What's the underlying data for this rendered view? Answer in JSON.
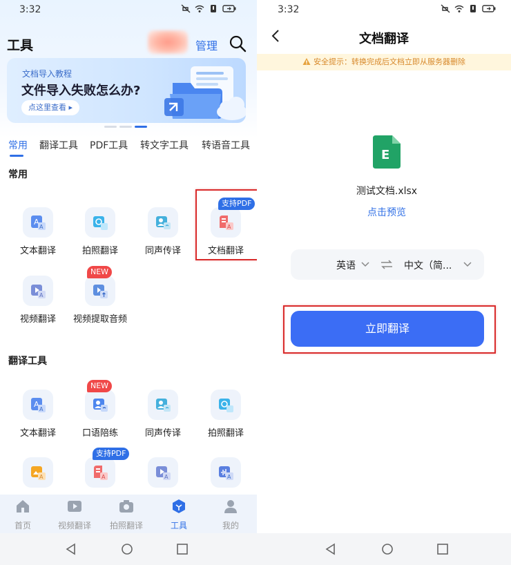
{
  "left": {
    "status": {
      "time": "3:32"
    },
    "header": {
      "title": "工具",
      "manage_label": "管理"
    },
    "banner": {
      "subtitle": "文档导入教程",
      "headline": "文件导入失败怎么办?",
      "button_label": "点这里查看 ▸"
    },
    "tabs": [
      "常用",
      "翻译工具",
      "PDF工具",
      "转文字工具",
      "转语音工具"
    ],
    "active_tab": "常用",
    "sections": {
      "common": {
        "title": "常用",
        "tools": [
          {
            "label": "文本翻译",
            "icon": "text-translate-icon"
          },
          {
            "label": "拍照翻译",
            "icon": "photo-translate-icon"
          },
          {
            "label": "同声传译",
            "icon": "simultaneous-interpret-icon"
          },
          {
            "label": "文档翻译",
            "icon": "document-translate-icon",
            "badge": "支持PDF"
          },
          {
            "label": "视频翻译",
            "icon": "video-translate-icon"
          },
          {
            "label": "视频提取音频",
            "icon": "video-extract-audio-icon",
            "badge": "NEW"
          }
        ]
      },
      "translate": {
        "title": "翻译工具",
        "tools": [
          {
            "label": "文本翻译",
            "icon": "text-translate-icon"
          },
          {
            "label": "口语陪练",
            "icon": "speaking-practice-icon",
            "badge": "NEW"
          },
          {
            "label": "同声传译",
            "icon": "simultaneous-interpret-icon"
          },
          {
            "label": "拍照翻译",
            "icon": "photo-translate-icon"
          },
          {
            "label": "",
            "icon": "image-translate-icon"
          },
          {
            "label": "",
            "icon": "document-translate-icon",
            "badge": "支持PDF"
          },
          {
            "label": "",
            "icon": "video-translate-icon"
          },
          {
            "label": "",
            "icon": "audio-translate-icon"
          }
        ]
      }
    },
    "bottom_nav": [
      {
        "label": "首页",
        "icon": "home-icon"
      },
      {
        "label": "视频翻译",
        "icon": "video-icon"
      },
      {
        "label": "拍照翻译",
        "icon": "camera-icon"
      },
      {
        "label": "工具",
        "icon": "tools-icon",
        "active": true
      },
      {
        "label": "我的",
        "icon": "profile-icon"
      }
    ]
  },
  "right": {
    "status": {
      "time": "3:32"
    },
    "header": {
      "title": "文档翻译"
    },
    "warning": "安全提示：转换完成后文档立即从服务器删除",
    "file": {
      "name": "测试文档.xlsx",
      "icon_letter": "E",
      "preview_label": "点击预览"
    },
    "languages": {
      "source": "英语",
      "target": "中文（简..."
    },
    "translate_button": "立即翻译"
  },
  "colors": {
    "accent": "#2f6fe6",
    "button": "#3b6df5",
    "highlight": "#d92b2b",
    "warning_bg": "#fff6dd",
    "warning_text": "#d7882a",
    "excel_green": "#21a366"
  }
}
